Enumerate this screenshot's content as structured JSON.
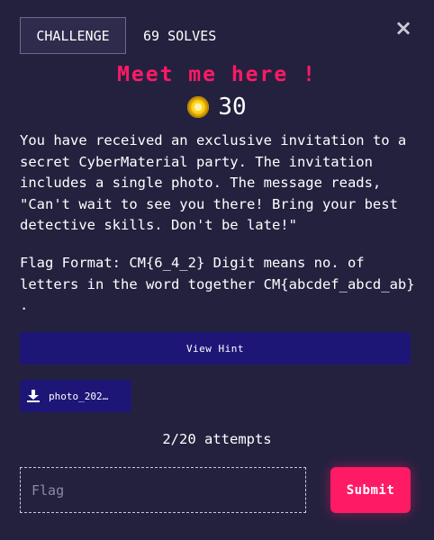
{
  "tabs": {
    "challenge_label": "CHALLENGE",
    "solves_label": "69 SOLVES"
  },
  "close_symbol": "×",
  "challenge": {
    "title": "Meet me here !",
    "points": "30",
    "coin_icon": "coin-icon",
    "description": "You have received an exclusive invitation to a secret CyberMaterial party. The invitation includes a single photo. The message reads, \"Can't wait to see you there! Bring your best detective skills. Don't be late!\"",
    "flag_format": "Flag Format: CM{6_4_2} Digit means no. of letters in the word together CM{abcdef_abcd_ab} ."
  },
  "hint_button_label": "View Hint",
  "file": {
    "label": "photo_202…",
    "icon": "download-icon"
  },
  "attempts_text": "2/20 attempts",
  "flag_input": {
    "placeholder": "Flag",
    "value": ""
  },
  "submit_label": "Submit",
  "colors": {
    "background": "#24213f",
    "accent": "#ff1a66",
    "button_bg": "#1e1677"
  }
}
